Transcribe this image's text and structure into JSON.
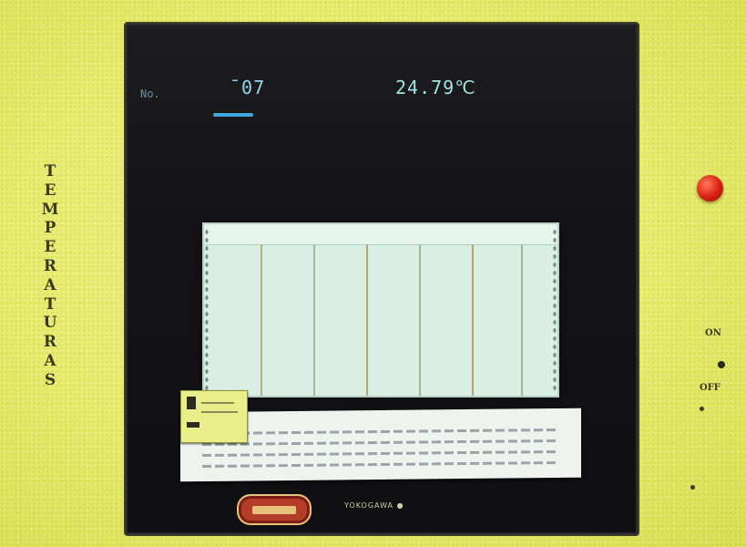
{
  "panel": {
    "vertical_label": [
      "T",
      "E",
      "M",
      "P",
      "E",
      "R",
      "A",
      "T",
      "U",
      "R",
      "A",
      "S"
    ]
  },
  "display": {
    "channel": "No.",
    "code": "¯07",
    "temperature": "24.79℃"
  },
  "chart": {
    "grid_colors": [
      "#b6a66c",
      "#a99c6a",
      "#9fb39b"
    ]
  },
  "footer": {
    "maker": "YOKOGAWA ●"
  },
  "controls": {
    "on_label": "ON",
    "off_label": "OFF",
    "lamp_color": "#d81f12"
  }
}
